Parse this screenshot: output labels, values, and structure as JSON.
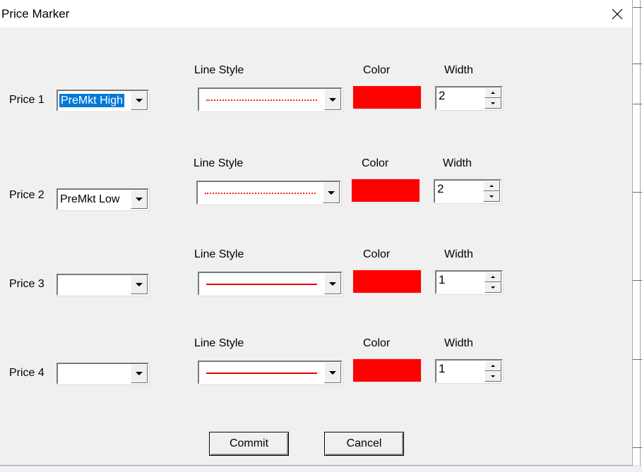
{
  "window": {
    "title": "Price Marker"
  },
  "headers": {
    "line_style": "Line Style",
    "color": "Color",
    "width": "Width"
  },
  "rows": [
    {
      "label": "Price 1",
      "price_value": "PreMkt High",
      "price_selected": true,
      "line_style": "dotted",
      "color": "#ff0000",
      "width": "2"
    },
    {
      "label": "Price 2",
      "price_value": "PreMkt Low",
      "price_selected": false,
      "line_style": "dotted",
      "color": "#ff0000",
      "width": "2"
    },
    {
      "label": "Price 3",
      "price_value": "",
      "price_selected": false,
      "line_style": "solid",
      "color": "#ff0000",
      "width": "1"
    },
    {
      "label": "Price 4",
      "price_value": "",
      "price_selected": false,
      "line_style": "solid",
      "color": "#ff0000",
      "width": "1"
    }
  ],
  "buttons": {
    "commit": "Commit",
    "cancel": "Cancel"
  },
  "icons": {
    "close": "close-icon",
    "dropdown": "chevron-down-icon",
    "spin_up": "spin-up-icon",
    "spin_down": "spin-down-icon"
  }
}
